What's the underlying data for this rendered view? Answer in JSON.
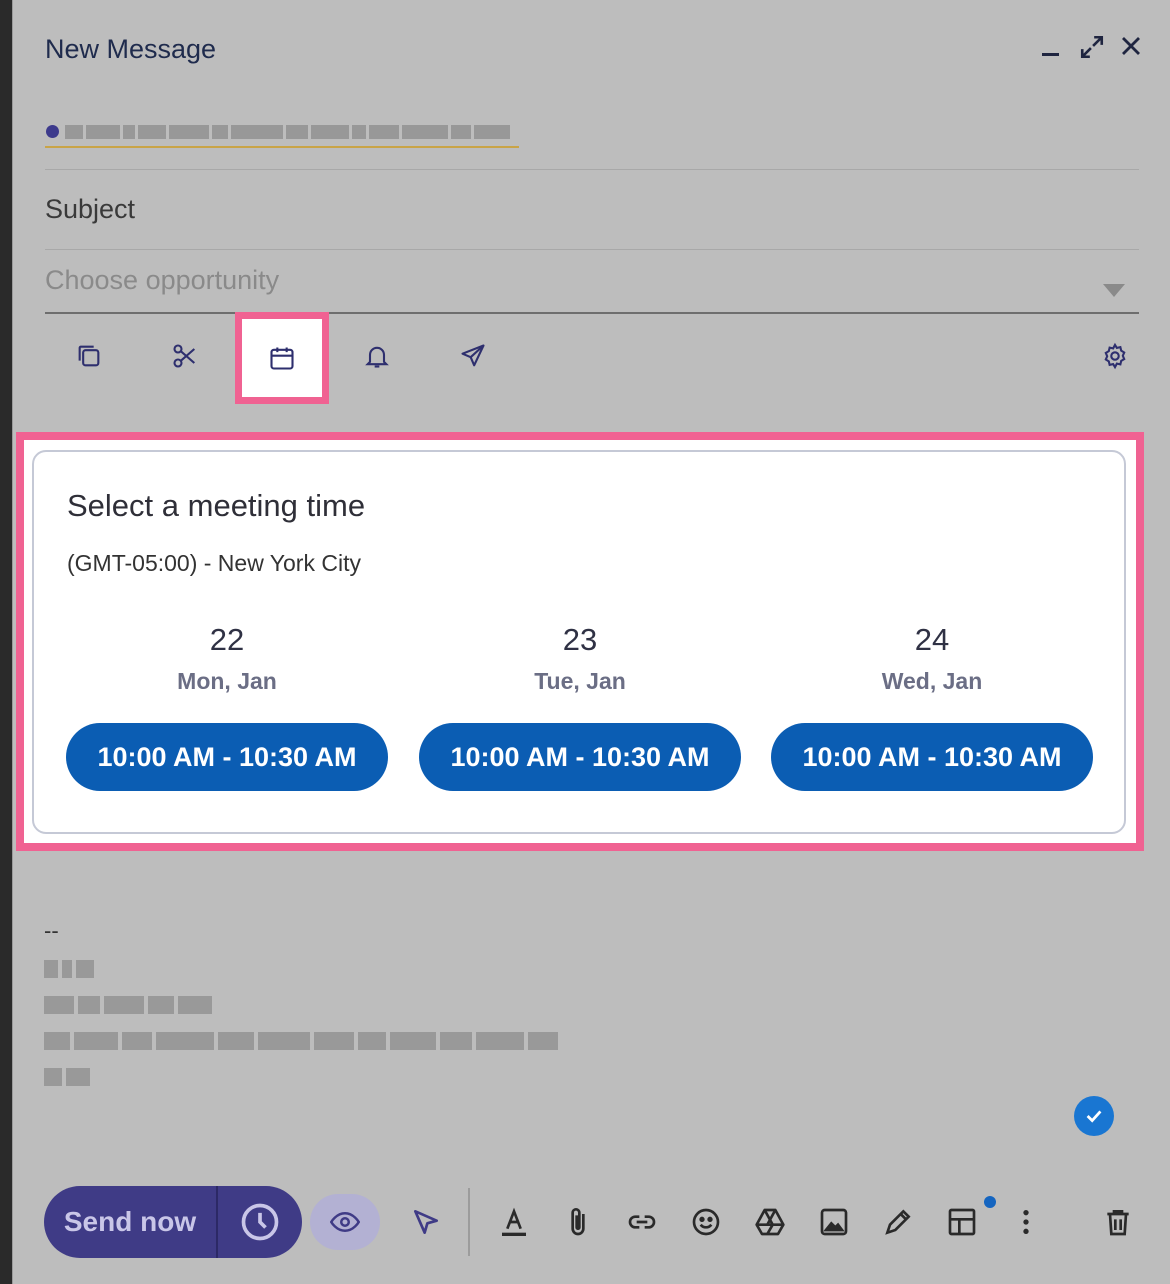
{
  "window": {
    "title": "New Message"
  },
  "compose": {
    "subject_placeholder": "Subject",
    "opportunity_placeholder": "Choose opportunity"
  },
  "toolbar": {
    "icons": [
      "copy-icon",
      "scissors-icon",
      "calendar-icon",
      "bell-icon",
      "send-icon",
      "settings-icon"
    ],
    "active": "calendar-icon"
  },
  "meeting": {
    "title": "Select a meeting time",
    "timezone": "(GMT-05:00) - New York City",
    "days": [
      {
        "num": "22",
        "label": "Mon, Jan",
        "slot": "10:00 AM - 10:30 AM"
      },
      {
        "num": "23",
        "label": "Tue, Jan",
        "slot": "10:00 AM - 10:30 AM"
      },
      {
        "num": "24",
        "label": "Wed, Jan",
        "slot": "10:00 AM - 10:30 AM"
      }
    ]
  },
  "signature": {
    "dash": "--"
  },
  "bottom": {
    "send_label": "Send now"
  },
  "colors": {
    "highlight": "#f06292",
    "slot_button": "#0b5db3",
    "send_button": "#3f3b86"
  }
}
